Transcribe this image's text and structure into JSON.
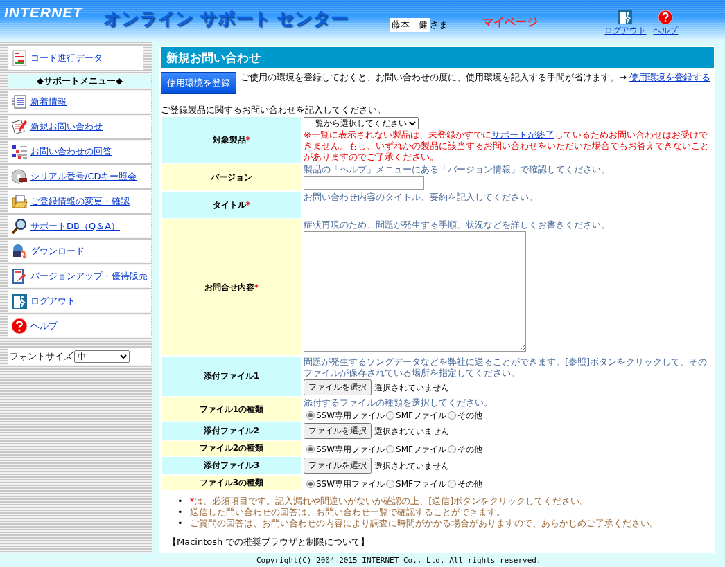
{
  "header": {
    "logo": "INTERNET",
    "title": "オンライン サポート センター",
    "user_name": "藤本　健",
    "honorific": "さま",
    "mypage": "マイページ",
    "links": [
      {
        "label": "ログアウト"
      },
      {
        "label": "ヘルプ"
      }
    ]
  },
  "sidebar": {
    "top_item": {
      "label": "コード進行データ"
    },
    "menu_heading": "◆サポートメニュー◆",
    "items": [
      {
        "label": "新着情報"
      },
      {
        "label": "新規お問い合わせ"
      },
      {
        "label": "お問い合わせの回答"
      },
      {
        "label": "シリアル番号/CDキー照会"
      },
      {
        "label": "ご登録情報の変更・確認"
      },
      {
        "label": "サポートDB（Q＆A）"
      },
      {
        "label": "ダウンロード"
      },
      {
        "label": "バージョンアップ・優待販売"
      },
      {
        "label": "ログアウト"
      },
      {
        "label": "ヘルプ"
      }
    ],
    "font_size": {
      "label": "フォントサイズ",
      "value": "中"
    }
  },
  "main": {
    "title": "新規お問い合わせ",
    "env_button": "使用環境を登録",
    "env_text": "ご使用の環境を登録しておくと、お問い合わせの度に、使用環境を記入する手間が省けます。→ ",
    "env_link": "使用環境を登録する",
    "intro": "ご登録製品に関するお問い合わせを記入してください。",
    "form_rows": [
      {
        "label": "対象製品",
        "required": true,
        "kind": "select",
        "value": "一覧から選択してください",
        "note_before": "※一覧に表示されない製品は、未登録かすでに",
        "note_link": "サポートが終了",
        "note_after": "しているためお問い合わせはお受けできません。もし、いずれかの製品に該当するお問い合わせをいただいた場合でもお答えできないことがありますのでご了承ください。"
      },
      {
        "label": "バージョン",
        "required": false,
        "kind": "text",
        "hint": "製品の「ヘルプ」メニューにある「バージョン情報」で確認してください。"
      },
      {
        "label": "タイトル",
        "required": true,
        "kind": "text_wide",
        "hint": "お問い合わせ内容のタイトル、要約を記入してください。"
      },
      {
        "label": "お問合せ内容",
        "required": true,
        "kind": "textarea",
        "hint": "症状再現のため、問題が発生する手順、状況などを詳しくお書きください。"
      },
      {
        "label": "添付ファイル1",
        "required": false,
        "kind": "file",
        "hint": "問題が発生するソングデータなどを弊社に送ることができます。[参照]ボタンをクリックして、そのファイルが保存されている場所を指定してください。",
        "button": "ファイルを選択",
        "status": "選択されていません"
      },
      {
        "label": "ファイル1の種類",
        "required": false,
        "kind": "radio",
        "hint": "添付するファイルの種類を選択してください。",
        "options": [
          {
            "label": "SSW専用ファイル",
            "selected": true
          },
          {
            "label": "SMFファイル",
            "selected": false
          },
          {
            "label": "その他",
            "selected": false
          }
        ]
      },
      {
        "label": "添付ファイル2",
        "required": false,
        "kind": "file",
        "button": "ファイルを選択",
        "status": "選択されていません"
      },
      {
        "label": "ファイル2の種類",
        "required": false,
        "kind": "radio",
        "options": [
          {
            "label": "SSW専用ファイル",
            "selected": true
          },
          {
            "label": "SMFファイル",
            "selected": false
          },
          {
            "label": "その他",
            "selected": false
          }
        ]
      },
      {
        "label": "添付ファイル3",
        "required": false,
        "kind": "file",
        "button": "ファイルを選択",
        "status": "選択されていません"
      },
      {
        "label": "ファイル3の種類",
        "required": false,
        "kind": "radio",
        "options": [
          {
            "label": "SSW専用ファイル",
            "selected": true
          },
          {
            "label": "SMFファイル",
            "selected": false
          },
          {
            "label": "その他",
            "selected": false
          }
        ]
      }
    ],
    "notes": [
      {
        "bullet": "•",
        "mark": "*",
        "text": "は、必須項目です。記入漏れや間違いがないか確認の上、[送信]ボタンをクリックしてください。"
      },
      {
        "bullet": "•",
        "text": "送信した問い合わせの回答は、お問い合わせ一覧で確認することができます。"
      },
      {
        "bullet": "•",
        "text": "ご質問の回答は、お問い合わせの内容により調査に時間がかかる場合がありますので、あらかじめご了承ください。"
      }
    ],
    "section_heading": "【Macintosh での推奨ブラウザと制限について】"
  },
  "footer": {
    "copyright": "Copyright(C) 2004-2015 INTERNET Co., Ltd. All rights reserved."
  }
}
